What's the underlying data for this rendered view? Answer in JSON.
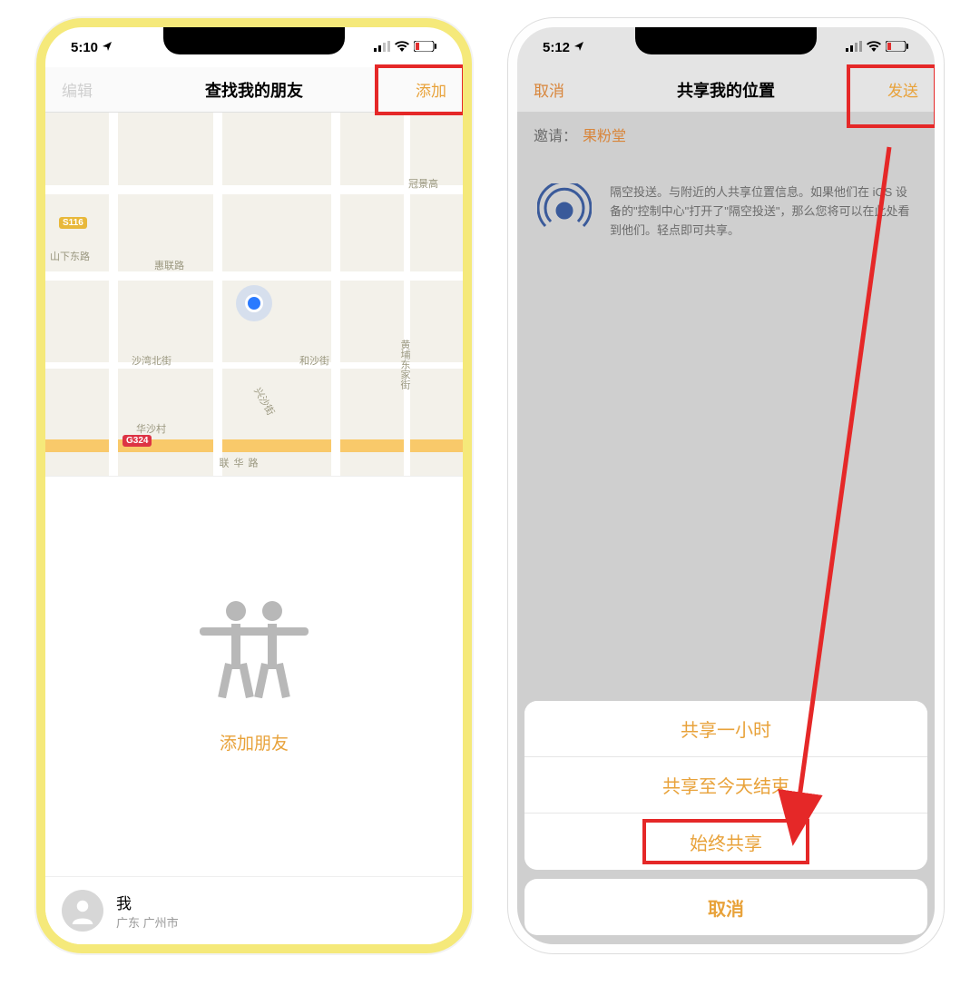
{
  "left": {
    "status_time": "5:10",
    "nav": {
      "left": "编辑",
      "title": "查找我的朋友",
      "right": "添加"
    },
    "map": {
      "road_labels": [
        "山下东路",
        "惠联路",
        "沙湾北街",
        "和沙街",
        "兴沙街",
        "联华路",
        "冠景高",
        "华沙村",
        "黄埔东家街"
      ],
      "shields": [
        "S116",
        "G324"
      ]
    },
    "empty": {
      "add_friend": "添加朋友"
    },
    "me": {
      "name": "我",
      "location": "广东 广州市"
    }
  },
  "right": {
    "status_time": "5:12",
    "nav": {
      "left": "取消",
      "title": "共享我的位置",
      "right": "发送"
    },
    "invite": {
      "label": "邀请：",
      "value": "果粉堂"
    },
    "airdrop_text": "隔空投送。与附近的人共享位置信息。如果他们在 iOS 设备的\"控制中心\"打开了\"隔空投送\"，那么您将可以在此处看到他们。轻点即可共享。",
    "sheet": {
      "option1": "共享一小时",
      "option2": "共享至今天结束",
      "option3": "始终共享",
      "cancel": "取消"
    }
  },
  "icons": {
    "location_arrow": "location-arrow-icon",
    "signal": "cellular-signal-icon",
    "wifi": "wifi-icon",
    "battery": "battery-low-icon",
    "airdrop": "airdrop-icon",
    "friends": "friends-icon",
    "avatar": "person-avatar-icon"
  }
}
